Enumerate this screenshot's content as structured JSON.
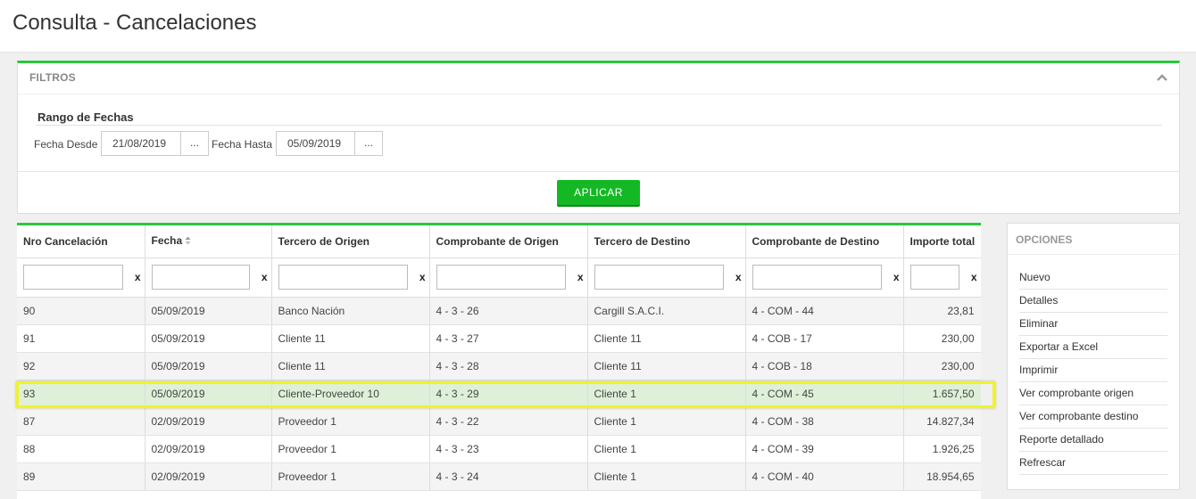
{
  "page": {
    "title": "Consulta - Cancelaciones"
  },
  "filters": {
    "title": "FILTROS",
    "range_title": "Rango de Fechas",
    "from_label": "Fecha Desde",
    "from_value": "21/08/2019",
    "to_label": "Fecha Hasta",
    "to_value": "05/09/2019",
    "picker_label": "...",
    "apply_label": "APLICAR"
  },
  "grid": {
    "columns": [
      "Nro Cancelación",
      "Fecha",
      "Tercero de Origen",
      "Comprobante de Origen",
      "Tercero de Destino",
      "Comprobante de Destino",
      "Importe total"
    ],
    "clear_label": "x",
    "selected_row_index": 3,
    "rows": [
      [
        "90",
        "05/09/2019",
        "Banco Nación",
        "4 - 3 - 26",
        "Cargill S.A.C.I.",
        "4 - COM - 44",
        "23,81"
      ],
      [
        "91",
        "05/09/2019",
        "Cliente 11",
        "4 - 3 - 27",
        "Cliente 11",
        "4 - COB - 17",
        "230,00"
      ],
      [
        "92",
        "05/09/2019",
        "Cliente 11",
        "4 - 3 - 28",
        "Cliente 11",
        "4 - COB - 18",
        "230,00"
      ],
      [
        "93",
        "05/09/2019",
        "Cliente-Proveedor 10",
        "4 - 3 - 29",
        "Cliente 1",
        "4 - COM - 45",
        "1.657,50"
      ],
      [
        "87",
        "02/09/2019",
        "Proveedor 1",
        "4 - 3 - 22",
        "Cliente 1",
        "4 - COM - 38",
        "14.827,34"
      ],
      [
        "88",
        "02/09/2019",
        "Proveedor 1",
        "4 - 3 - 23",
        "Cliente 1",
        "4 - COM - 39",
        "1.926,25"
      ],
      [
        "89",
        "02/09/2019",
        "Proveedor 1",
        "4 - 3 - 24",
        "Cliente 1",
        "4 - COM - 40",
        "18.954,65"
      ]
    ]
  },
  "options": {
    "title": "OPCIONES",
    "items": [
      "Nuevo",
      "Detalles",
      "Eliminar",
      "Exportar a Excel",
      "Imprimir",
      "Ver comprobante origen",
      "Ver comprobante destino",
      "Reporte detallado",
      "Refrescar"
    ]
  },
  "colors": {
    "accent": "#2bc73a",
    "apply_button": "#14b824",
    "selected_row": "#dff0d8",
    "highlight": "#f2f22a"
  },
  "icons": {
    "collapse": "chevron-up-icon",
    "sort": "sort-icon"
  }
}
